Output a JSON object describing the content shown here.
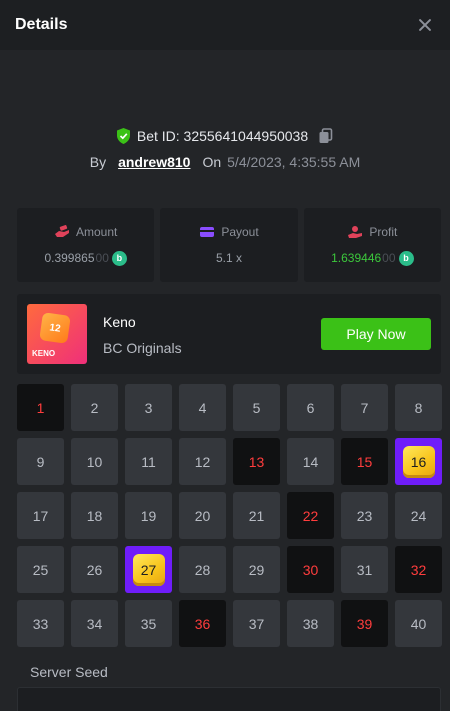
{
  "header": {
    "title": "Details"
  },
  "bet": {
    "id_label": "Bet ID: 3255641044950038",
    "by_label": "By",
    "username": "andrew810",
    "on_label": "On",
    "datetime": "5/4/2023, 4:35:55 AM"
  },
  "stats": [
    {
      "label": "Amount",
      "value_main": "0.399865",
      "value_dim": "00",
      "icon": "hand-coins-icon",
      "color": "#e0425a",
      "coin": "bcd-coin-icon"
    },
    {
      "label": "Payout",
      "value_main": "5.1 x",
      "value_dim": "",
      "icon": "card-icon",
      "color": "#8a4dff"
    },
    {
      "label": "Profit",
      "value_main": "1.639446",
      "value_dim": "00",
      "icon": "user-coins-icon",
      "color": "#e0425a",
      "coin": "bcd-coin-icon"
    }
  ],
  "game": {
    "name": "Keno",
    "provider": "BC Originals",
    "play_label": "Play Now",
    "thumb_text": "KENO",
    "thumb_number": "12"
  },
  "grid": [
    {
      "n": "1",
      "state": "miss"
    },
    {
      "n": "2",
      "state": "idle"
    },
    {
      "n": "3",
      "state": "idle"
    },
    {
      "n": "4",
      "state": "idle"
    },
    {
      "n": "5",
      "state": "idle"
    },
    {
      "n": "6",
      "state": "idle"
    },
    {
      "n": "7",
      "state": "idle"
    },
    {
      "n": "8",
      "state": "idle"
    },
    {
      "n": "9",
      "state": "idle"
    },
    {
      "n": "10",
      "state": "idle"
    },
    {
      "n": "11",
      "state": "idle"
    },
    {
      "n": "12",
      "state": "idle"
    },
    {
      "n": "13",
      "state": "miss"
    },
    {
      "n": "14",
      "state": "idle"
    },
    {
      "n": "15",
      "state": "miss"
    },
    {
      "n": "16",
      "state": "hit"
    },
    {
      "n": "17",
      "state": "idle"
    },
    {
      "n": "18",
      "state": "idle"
    },
    {
      "n": "19",
      "state": "idle"
    },
    {
      "n": "20",
      "state": "idle"
    },
    {
      "n": "21",
      "state": "idle"
    },
    {
      "n": "22",
      "state": "miss"
    },
    {
      "n": "23",
      "state": "idle"
    },
    {
      "n": "24",
      "state": "idle"
    },
    {
      "n": "25",
      "state": "idle"
    },
    {
      "n": "26",
      "state": "idle"
    },
    {
      "n": "27",
      "state": "hit"
    },
    {
      "n": "28",
      "state": "idle"
    },
    {
      "n": "29",
      "state": "idle"
    },
    {
      "n": "30",
      "state": "miss"
    },
    {
      "n": "31",
      "state": "idle"
    },
    {
      "n": "32",
      "state": "miss"
    },
    {
      "n": "33",
      "state": "idle"
    },
    {
      "n": "34",
      "state": "idle"
    },
    {
      "n": "35",
      "state": "idle"
    },
    {
      "n": "36",
      "state": "miss"
    },
    {
      "n": "37",
      "state": "idle"
    },
    {
      "n": "38",
      "state": "idle"
    },
    {
      "n": "39",
      "state": "miss"
    },
    {
      "n": "40",
      "state": "idle"
    }
  ],
  "seed": {
    "label": "Server Seed"
  },
  "colors": {
    "accent_green": "#3bc117",
    "hit_purple": "#6f1dfa",
    "miss_red": "#ff3d3d",
    "profit_green": "#3cc83c"
  }
}
